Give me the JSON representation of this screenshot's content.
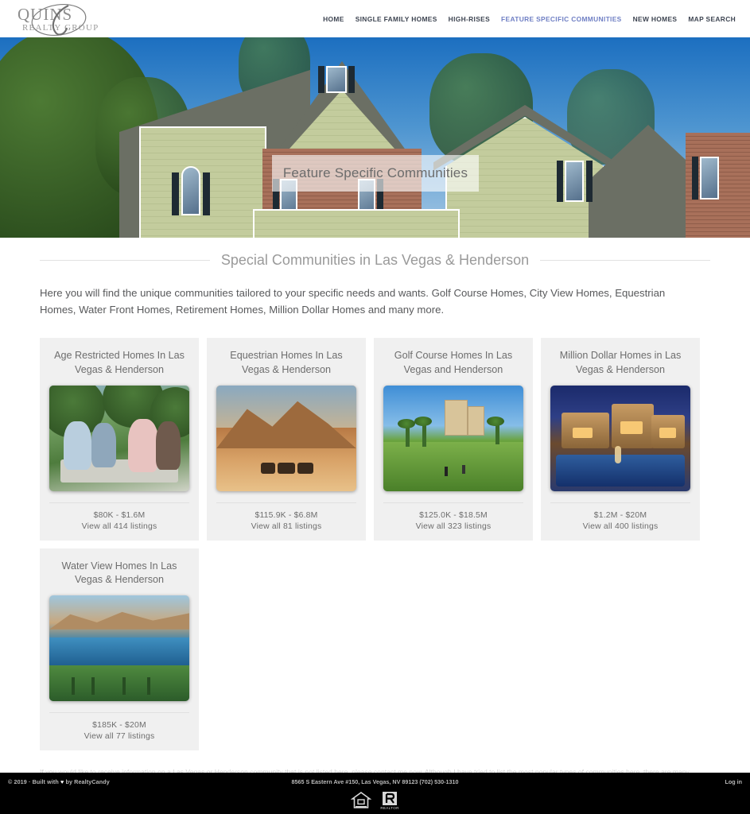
{
  "header": {
    "logo_text": "QUINS",
    "logo_sub": "REALTY GROUP",
    "logo_name": "quins-realty-group-logo",
    "nav": [
      {
        "label": "HOME",
        "active": false
      },
      {
        "label": "SINGLE FAMILY HOMES",
        "active": false
      },
      {
        "label": "HIGH-RISES",
        "active": false
      },
      {
        "label": "FEATURE SPECIFIC COMMUNITIES",
        "active": true
      },
      {
        "label": "NEW HOMES",
        "active": false
      },
      {
        "label": "MAP SEARCH",
        "active": false
      }
    ],
    "active_color": "#6f7fc4"
  },
  "hero": {
    "title": "Feature Specific Communities"
  },
  "section": {
    "title": "Special Communities in Las Vegas & Henderson",
    "intro": "Here you will find the unique communities tailored to your specific needs and wants.  Golf Course Homes, City View Homes, Equestrian Homes, Water Front Homes, Retirement Homes, Million Dollar Homes and many more."
  },
  "cards": [
    {
      "title": "Age Restricted Homes In Las Vegas & Henderson",
      "price": "$80K - $1.6M",
      "view": "View all 414 listings",
      "photo": "seniors-toasting-photo"
    },
    {
      "title": "Equestrian Homes In Las Vegas & Henderson",
      "price": "$115.9K - $6.8M",
      "view": "View all 81 listings",
      "photo": "horseback-riders-desert-photo"
    },
    {
      "title": "Golf Course Homes In Las Vegas and Henderson",
      "price": "$125.0K - $18.5M",
      "view": "View all 323 listings",
      "photo": "golf-course-resort-photo"
    },
    {
      "title": "Million Dollar Homes in Las Vegas & Henderson",
      "price": "$1.2M - $20M",
      "view": "View all 400 listings",
      "photo": "luxury-mansion-pool-photo"
    },
    {
      "title": "Water View Homes In Las Vegas & Henderson",
      "price": "$185K - $20M",
      "view": "View all 77 listings",
      "photo": "lake-water-view-photo"
    }
  ],
  "disclaimer": "If you would like to receive information on a Las Vegas or Henderson community that is not listed here, please contact me now.  Although I have tried to list the most popular types of communities here, there are many smaller and less known communities in Las Vegas and Henderson that offer many unique features.  I would be happy to go over these great hidden areas with you.",
  "footer": {
    "copyright_pre": "© 2019 ·  Built with ",
    "copyright_post": " by RealtyCandy",
    "heart": "♥",
    "address": "8565 S Eastern Ave #150, Las Vegas, NV 89123 (702) 530-1310",
    "login": "Log in",
    "background": "#000000"
  }
}
